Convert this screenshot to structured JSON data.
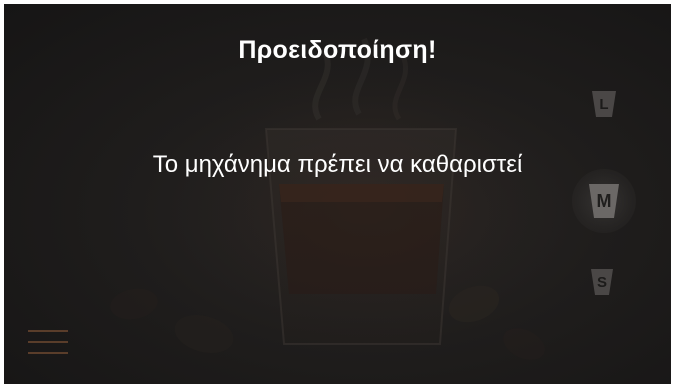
{
  "dialog": {
    "title": "Προειδοποίηση!",
    "message": "Το μηχάνημα πρέπει να καθαριστεί"
  },
  "cup_sizes": {
    "large_label": "L",
    "medium_label": "M",
    "small_label": "S",
    "selected": "M"
  },
  "menu": {
    "icon": "hamburger-menu-icon"
  },
  "colors": {
    "background": "#1f1d1c",
    "text": "#ffffff",
    "menu_accent": "#5a3d2a",
    "cup_icon": "#4a4746"
  }
}
